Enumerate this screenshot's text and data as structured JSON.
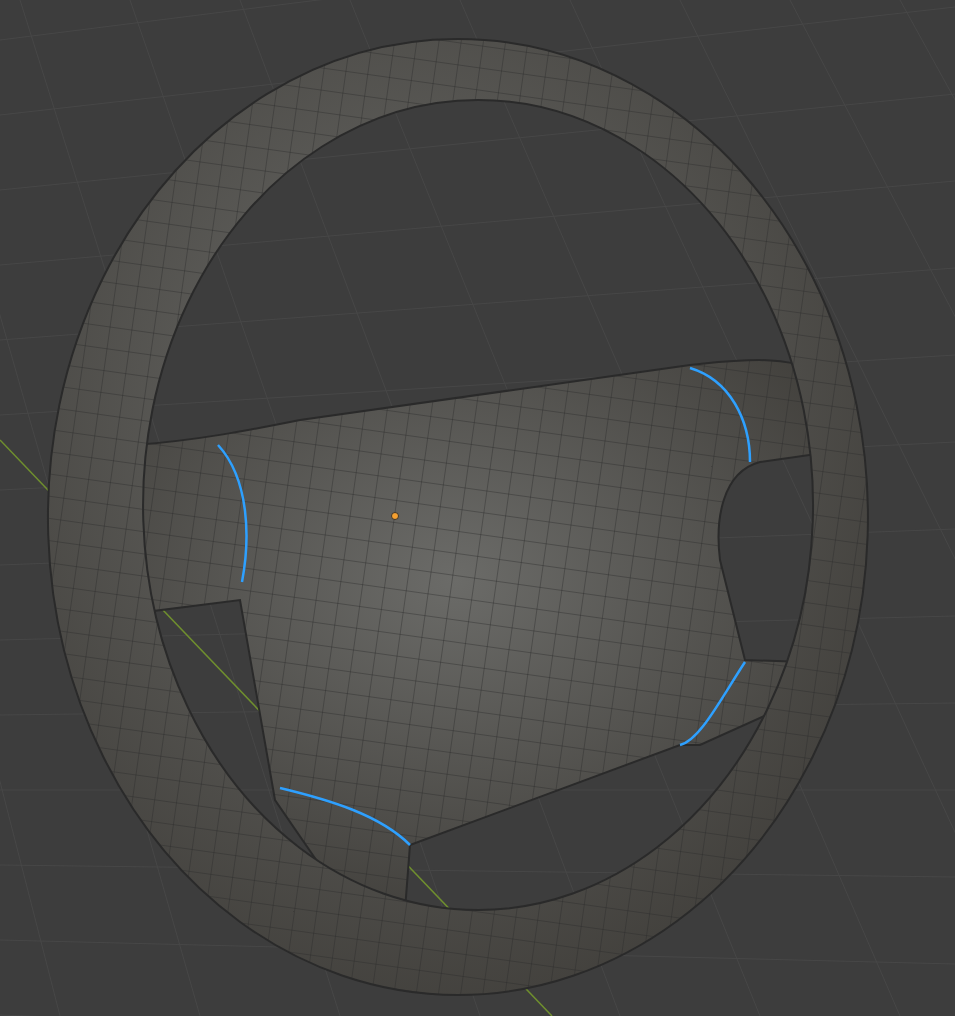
{
  "viewport": {
    "show_floor_grid": true,
    "show_origin": true
  }
}
